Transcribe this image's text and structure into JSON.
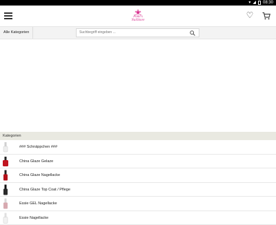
{
  "status_bar": {
    "time": "08:30"
  },
  "app_bar": {
    "logo_text_line1": "Pami's",
    "logo_text_line2": "NailStore"
  },
  "toolbar": {
    "all_categories_label": "Alle Kategorien",
    "search_placeholder": "Suchbegriff eingeben ..."
  },
  "categories": {
    "header": "Kategorien",
    "items": [
      {
        "label": "### Schnäppchen ###",
        "thumb": "nail-polish-clear"
      },
      {
        "label": "China Glaze Gelaze",
        "thumb": "nail-polish-red"
      },
      {
        "label": "China Glaze Nagellacke",
        "thumb": "nail-polish-red"
      },
      {
        "label": "China Glaze Top Coat / Pflege",
        "thumb": "nail-polish-black"
      },
      {
        "label": "Essie GEL Nagellacke",
        "thumb": "nail-polish-pink"
      },
      {
        "label": "Essie Nagellacke",
        "thumb": "nail-polish-white"
      }
    ]
  },
  "colors": {
    "brand": "#d62f8e",
    "toolbar_bg": "#f3f3f3",
    "category_header_bg": "#e9e9e1"
  }
}
